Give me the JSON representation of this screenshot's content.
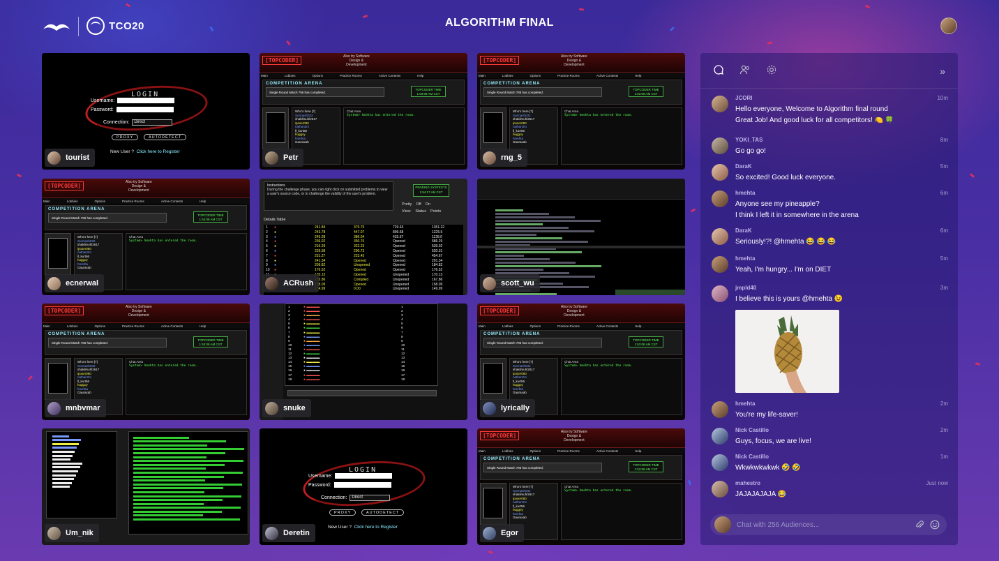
{
  "header": {
    "title": "ALGORITHM FINAL",
    "brand": "TCO20",
    "logo_icon": "topcoder-logo-icon",
    "user_avatar": "user-avatar"
  },
  "tiles": [
    {
      "username": "tourist",
      "view": "login"
    },
    {
      "username": "Petr",
      "view": "arena"
    },
    {
      "username": "rng_5",
      "view": "arena"
    },
    {
      "username": "ecnerwal",
      "view": "arena"
    },
    {
      "username": "ACRush",
      "view": "details"
    },
    {
      "username": "scott_wu",
      "view": "ide"
    },
    {
      "username": "mnbvmar",
      "view": "arena"
    },
    {
      "username": "snuke",
      "view": "list"
    },
    {
      "username": "lyrically",
      "view": "arena"
    },
    {
      "username": "Um_nik",
      "view": "chatlog"
    },
    {
      "username": "Deretin",
      "view": "login"
    },
    {
      "username": "Egor",
      "view": "arena"
    }
  ],
  "arena": {
    "logo": "[TOPCODER]",
    "also": "Also try Software\nDesign &\nDevelopment",
    "menu": [
      "Main",
      "Lobbies",
      "Options",
      "Practice Rooms",
      "Active Contests",
      "Help"
    ],
    "arena_title": "COMPETITION ARENA",
    "round": "Single Round Match 786 has completed.",
    "clock_label": "TOPCODER TIME",
    "clock_time": "1:53:08 AM CST",
    "whos_here": "Who's here [7]",
    "chat_area": "Chat Area",
    "chat_line": "System> hmehta has entered the room.",
    "users": [
      "Surmash032",
      "shakilmuhl2617",
      "iposer080",
      "nathan2m",
      "ll_kurt56",
      "huggoy",
      "hmehta",
      "Gauraxab"
    ]
  },
  "login": {
    "title": "LOGIN",
    "username_label": "Username:",
    "password_label": "Password:",
    "connection_label": "Connection:",
    "connection_value": "Direct",
    "proxy": "PROXY",
    "autodetect": "AUTODETECT",
    "new_user": "New User ?",
    "register": "Click here to Register"
  },
  "details": {
    "instructions": "Instructions",
    "instructions_text": "During the challenge phase, you can right click on submitted problems to view a user's source code, or to challenge the validity of the user's problem.",
    "pending": "PENDING SYSTESTS",
    "pending_time": "1:54:17 AM CST",
    "table_title": "Details Table",
    "pretty": "Pretty",
    "off": "Off",
    "on": "On",
    "view": "View:",
    "status": "Status",
    "points": "Points",
    "rows": [
      [
        "1",
        "241.84",
        "379.75",
        "729.63",
        "1351.22"
      ],
      [
        "2",
        "243.78",
        "447.07",
        "899.68",
        "1225.5"
      ],
      [
        "3",
        "245.28",
        "386.04",
        "433.67",
        "1128.0"
      ],
      [
        "4",
        "236.02",
        "350.76",
        "Opened",
        "586.29"
      ],
      [
        "5",
        "216.29",
        "322.23",
        "Opened",
        "539.02"
      ],
      [
        "6",
        "229.58",
        "290.73",
        "Opened",
        "520.31"
      ],
      [
        "7",
        "231.27",
        "223.45",
        "Opened",
        "454.67"
      ],
      [
        "8",
        "241.34",
        "Opened",
        "Opened",
        "291.34"
      ],
      [
        "9",
        "209.82",
        "Unopened",
        "Opened",
        "184.82"
      ],
      [
        "10",
        "176.52",
        "Opened",
        "Opened",
        "176.52"
      ],
      [
        "11",
        "170.13",
        "Opened",
        "Unopened",
        "170.13"
      ],
      [
        "12",
        "162.86",
        "Compiled",
        "Unopened",
        "167.86"
      ],
      [
        "13",
        "158.09",
        "Opened",
        "Unopened",
        "158.09"
      ],
      [
        "14",
        "174.99",
        "0.00",
        "Unopened",
        "149.99"
      ]
    ]
  },
  "chat": {
    "placeholder": "Chat with 256 Audiences...",
    "messages": [
      {
        "user": "JCORI",
        "time": "10m",
        "lines": [
          "Hello everyone, Welcome to Algorithm final round",
          "Great Job! And good luck for all competitors! 🍋 🍀"
        ]
      },
      {
        "user": "YOKI_TAS",
        "time": "8m",
        "lines": [
          "Go go go!"
        ]
      },
      {
        "user": "DaraK",
        "time": "5m",
        "lines": [
          "So excited! Good luck everyone."
        ]
      },
      {
        "user": "hmehta",
        "time": "6m",
        "lines": [
          "Anyone see my pineapple?",
          "I think I left it in somewhere in the arena"
        ]
      },
      {
        "user": "DaraK",
        "time": "6m",
        "lines": [
          "Seriously!?! @hmehta 😂 😂 😂"
        ]
      },
      {
        "user": "hmehta",
        "time": "5m",
        "lines": [
          "Yeah, I'm hungry... I'm on DIET"
        ]
      },
      {
        "user": "jmpld40",
        "time": "3m",
        "lines": [
          "I believe this is yours @hmehta 😉"
        ]
      },
      {
        "user": "hmehta",
        "time": "2m",
        "lines": [
          "You're my life-saver!"
        ]
      },
      {
        "user": "Nick Castillo",
        "time": "2m",
        "lines": [
          "Guys, focus, we are live!"
        ]
      },
      {
        "user": "Nick Castillo",
        "time": "1m",
        "lines": [
          "Wkwkwkwkwk 🤣 🤣"
        ]
      },
      {
        "user": "mahestro",
        "time": "Just now",
        "lines": [
          "JAJAJAJAJA 😂"
        ]
      }
    ]
  },
  "colors": {
    "accent_red": "#c01e1e",
    "terminal_green": "#4d4",
    "chat_panel": "#261a70"
  }
}
